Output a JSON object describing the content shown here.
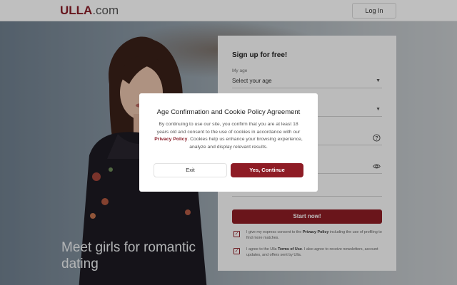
{
  "header": {
    "logo": {
      "u": "U",
      "ll": "LLA",
      "domain": ".com"
    },
    "login_label": "Log In"
  },
  "hero": {
    "headline": "Meet girls for romantic dating"
  },
  "signup": {
    "title": "Sign up for free!",
    "age_label": "My age",
    "age_placeholder": "Select your age",
    "start_label": "Start now!",
    "consent_1_prefix": "I give my express consent to the ",
    "consent_1_link": "Privacy Policy",
    "consent_1_suffix": " including the use of profiling to find more matches.",
    "consent_2_prefix": "I agree to the Ulla ",
    "consent_2_link": "Terms of Use",
    "consent_2_suffix": ". I also agree to receive newsletters, account updates, and offers sent by Ulla.",
    "checkmark": "✓"
  },
  "modal": {
    "title": "Age Confirmation and Cookie Policy Agreement",
    "body_prefix": "By continuing to use our site, you confirm that you are at least 18 years old and consent to the use of cookies in accordance with our ",
    "body_link": "Privacy Policy",
    "body_suffix": ". Cookies help us enhance your browsing experience, analyze and display relevant results.",
    "exit_label": "Exit",
    "continue_label": "Yes, Continue"
  },
  "colors": {
    "brand": "#8e1c25",
    "overlay": "rgba(0,0,0,0.25)"
  },
  "icons": {
    "dropdown": "chevron-down-icon",
    "help": "question-circle-icon",
    "password_toggle": "eye-icon"
  }
}
